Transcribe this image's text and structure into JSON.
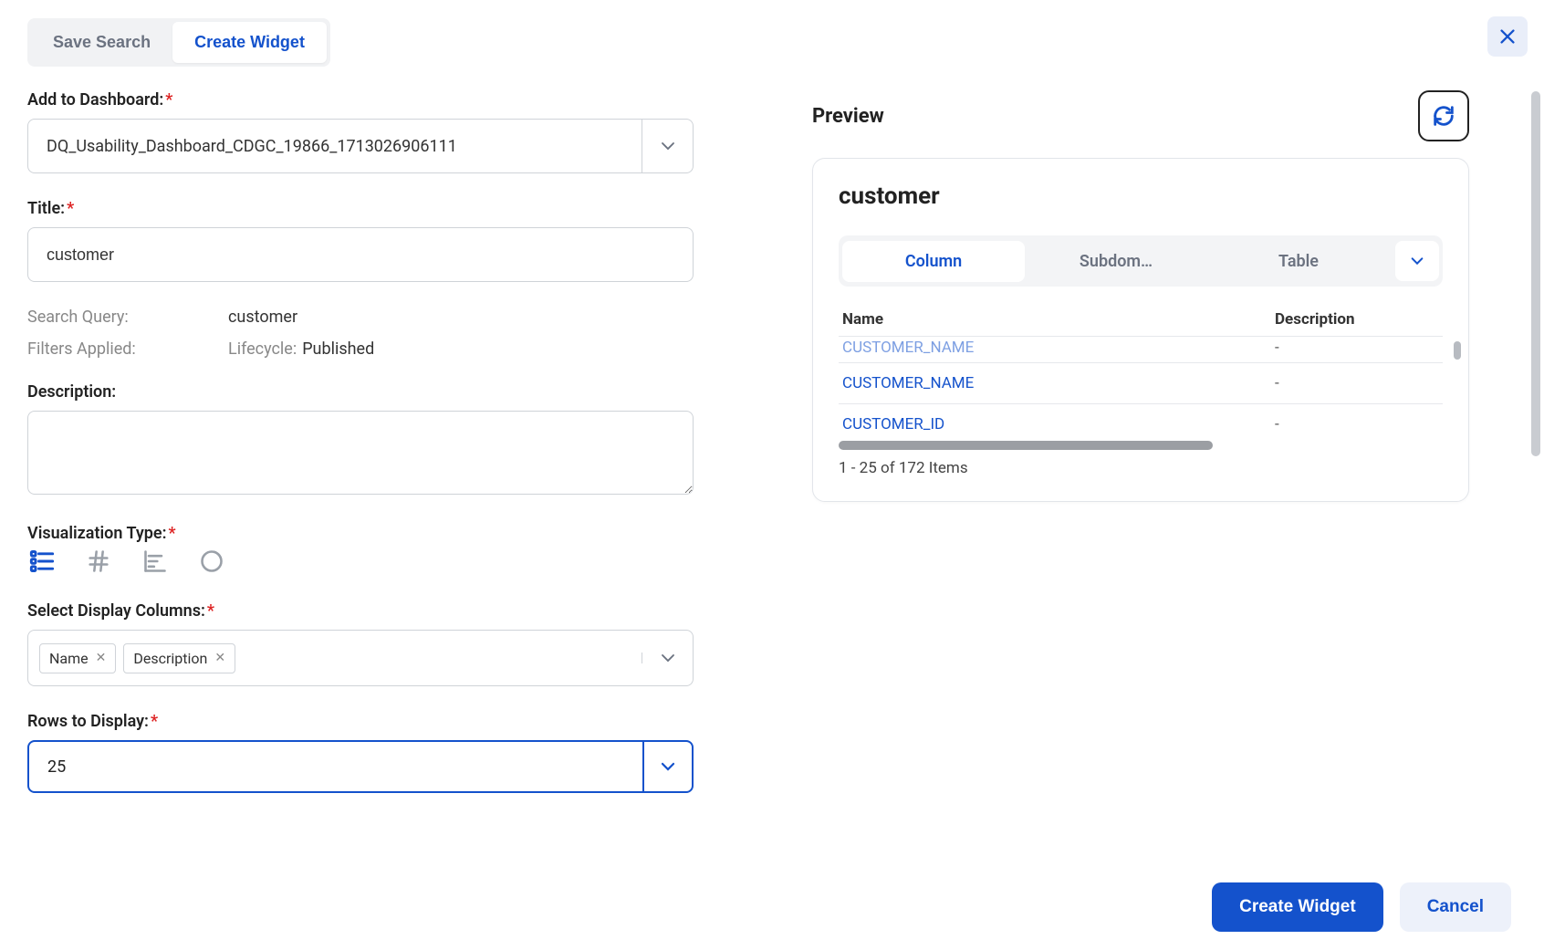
{
  "top_tabs": {
    "save_search": "Save Search",
    "create_widget": "Create Widget"
  },
  "form": {
    "dashboard_label": "Add to Dashboard:",
    "dashboard_value": "DQ_Usability_Dashboard_CDGC_19866_1713026906111",
    "title_label": "Title:",
    "title_value": "customer",
    "search_query_label": "Search Query:",
    "search_query_value": "customer",
    "filters_label": "Filters Applied:",
    "filters_key": "Lifecycle:",
    "filters_value": "Published",
    "description_label": "Description:",
    "description_value": "",
    "viz_label": "Visualization Type:",
    "columns_label": "Select Display Columns:",
    "columns": [
      "Name",
      "Description"
    ],
    "rows_label": "Rows to Display:",
    "rows_value": "25"
  },
  "preview": {
    "heading": "Preview",
    "title": "customer",
    "tabs": [
      "Column",
      "Subdom…",
      "Table"
    ],
    "table": {
      "headers": {
        "name": "Name",
        "desc": "Description"
      },
      "rows": [
        {
          "name": "CUSTOMER_NAME",
          "desc": "-",
          "cut": true
        },
        {
          "name": "CUSTOMER_NAME",
          "desc": "-"
        },
        {
          "name": "CUSTOMER_ID",
          "desc": "-"
        }
      ],
      "pager": "1 - 25 of 172 Items"
    }
  },
  "footer": {
    "create": "Create Widget",
    "cancel": "Cancel"
  }
}
